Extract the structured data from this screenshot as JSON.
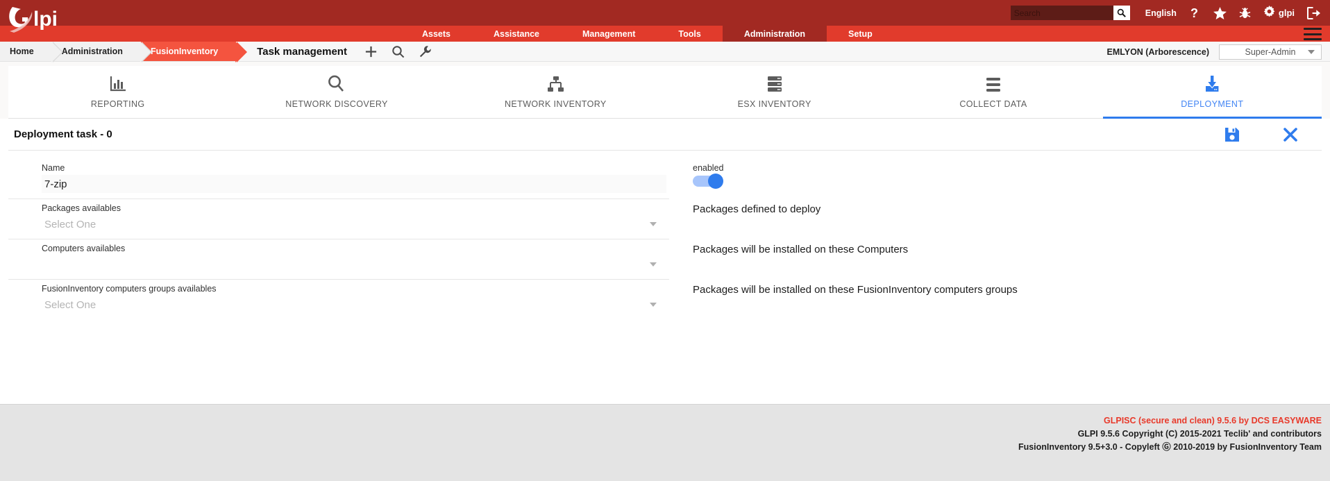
{
  "header": {
    "logo_text": "glpi",
    "search": {
      "placeholder": "Search",
      "value": "",
      "button_icon": "search-icon"
    },
    "language": "English",
    "icons": [
      "help-icon",
      "star-icon",
      "bug-icon",
      "gear-icon",
      "logout-icon"
    ],
    "user_name": "glpi"
  },
  "mainnav": {
    "items": [
      {
        "label": "Assets",
        "active": false
      },
      {
        "label": "Assistance",
        "active": false
      },
      {
        "label": "Management",
        "active": false
      },
      {
        "label": "Tools",
        "active": false
      },
      {
        "label": "Administration",
        "active": true
      },
      {
        "label": "Setup",
        "active": false
      }
    ],
    "menu_icon": "hamburger-icon"
  },
  "breadcrumb": {
    "items": [
      {
        "label": "Home",
        "highlight": false
      },
      {
        "label": "Administration",
        "highlight": false
      },
      {
        "label": "FusionInventory",
        "highlight": true
      }
    ],
    "page_title": "Task management",
    "actions": [
      "plus-icon",
      "search-icon",
      "wrench-icon"
    ],
    "entity": "EMLYON (Arborescence)",
    "profile": "Super-Admin"
  },
  "tabs": [
    {
      "label": "REPORTING",
      "icon": "bar-chart-icon",
      "active": false
    },
    {
      "label": "NETWORK DISCOVERY",
      "icon": "magnifier-icon",
      "active": false
    },
    {
      "label": "NETWORK INVENTORY",
      "icon": "network-icon",
      "active": false
    },
    {
      "label": "ESX INVENTORY",
      "icon": "server-icon",
      "active": false
    },
    {
      "label": "COLLECT DATA",
      "icon": "list-icon",
      "active": false
    },
    {
      "label": "DEPLOYMENT",
      "icon": "download-icon",
      "active": true
    }
  ],
  "panel": {
    "title": "Deployment task - 0",
    "save_icon": "save-icon",
    "close_icon": "close-icon",
    "fields": {
      "name": {
        "label": "Name",
        "value": "7-zip"
      },
      "enabled": {
        "label": "enabled",
        "state": "on"
      },
      "packages": {
        "label": "Packages availables",
        "placeholder": "Select One",
        "value": "",
        "help": "Packages defined to deploy"
      },
      "computers": {
        "label": "Computers availables",
        "placeholder": "",
        "value": "",
        "help": "Packages will be installed on these Computers"
      },
      "groups": {
        "label": "FusionInventory computers groups availables",
        "placeholder": "Select One",
        "value": "",
        "help": "Packages will be installed on these FusionInventory computers groups"
      }
    }
  },
  "footer": {
    "line1": "GLPISC (secure and clean) 9.5.6 by DCS EASYWARE",
    "line2": "GLPI 9.5.6 Copyright (C) 2015-2021 Teclib' and contributors",
    "line3": "FusionInventory 9.5+3.0 - Copyleft Ⓖ 2010-2019 by FusionInventory Team"
  },
  "colors": {
    "header_dark_red": "#a22922",
    "nav_red": "#e13b2c",
    "crumb_highlight": "#f4543f",
    "accent_blue": "#2f7ced",
    "footer_brand_red": "#e8392a"
  }
}
